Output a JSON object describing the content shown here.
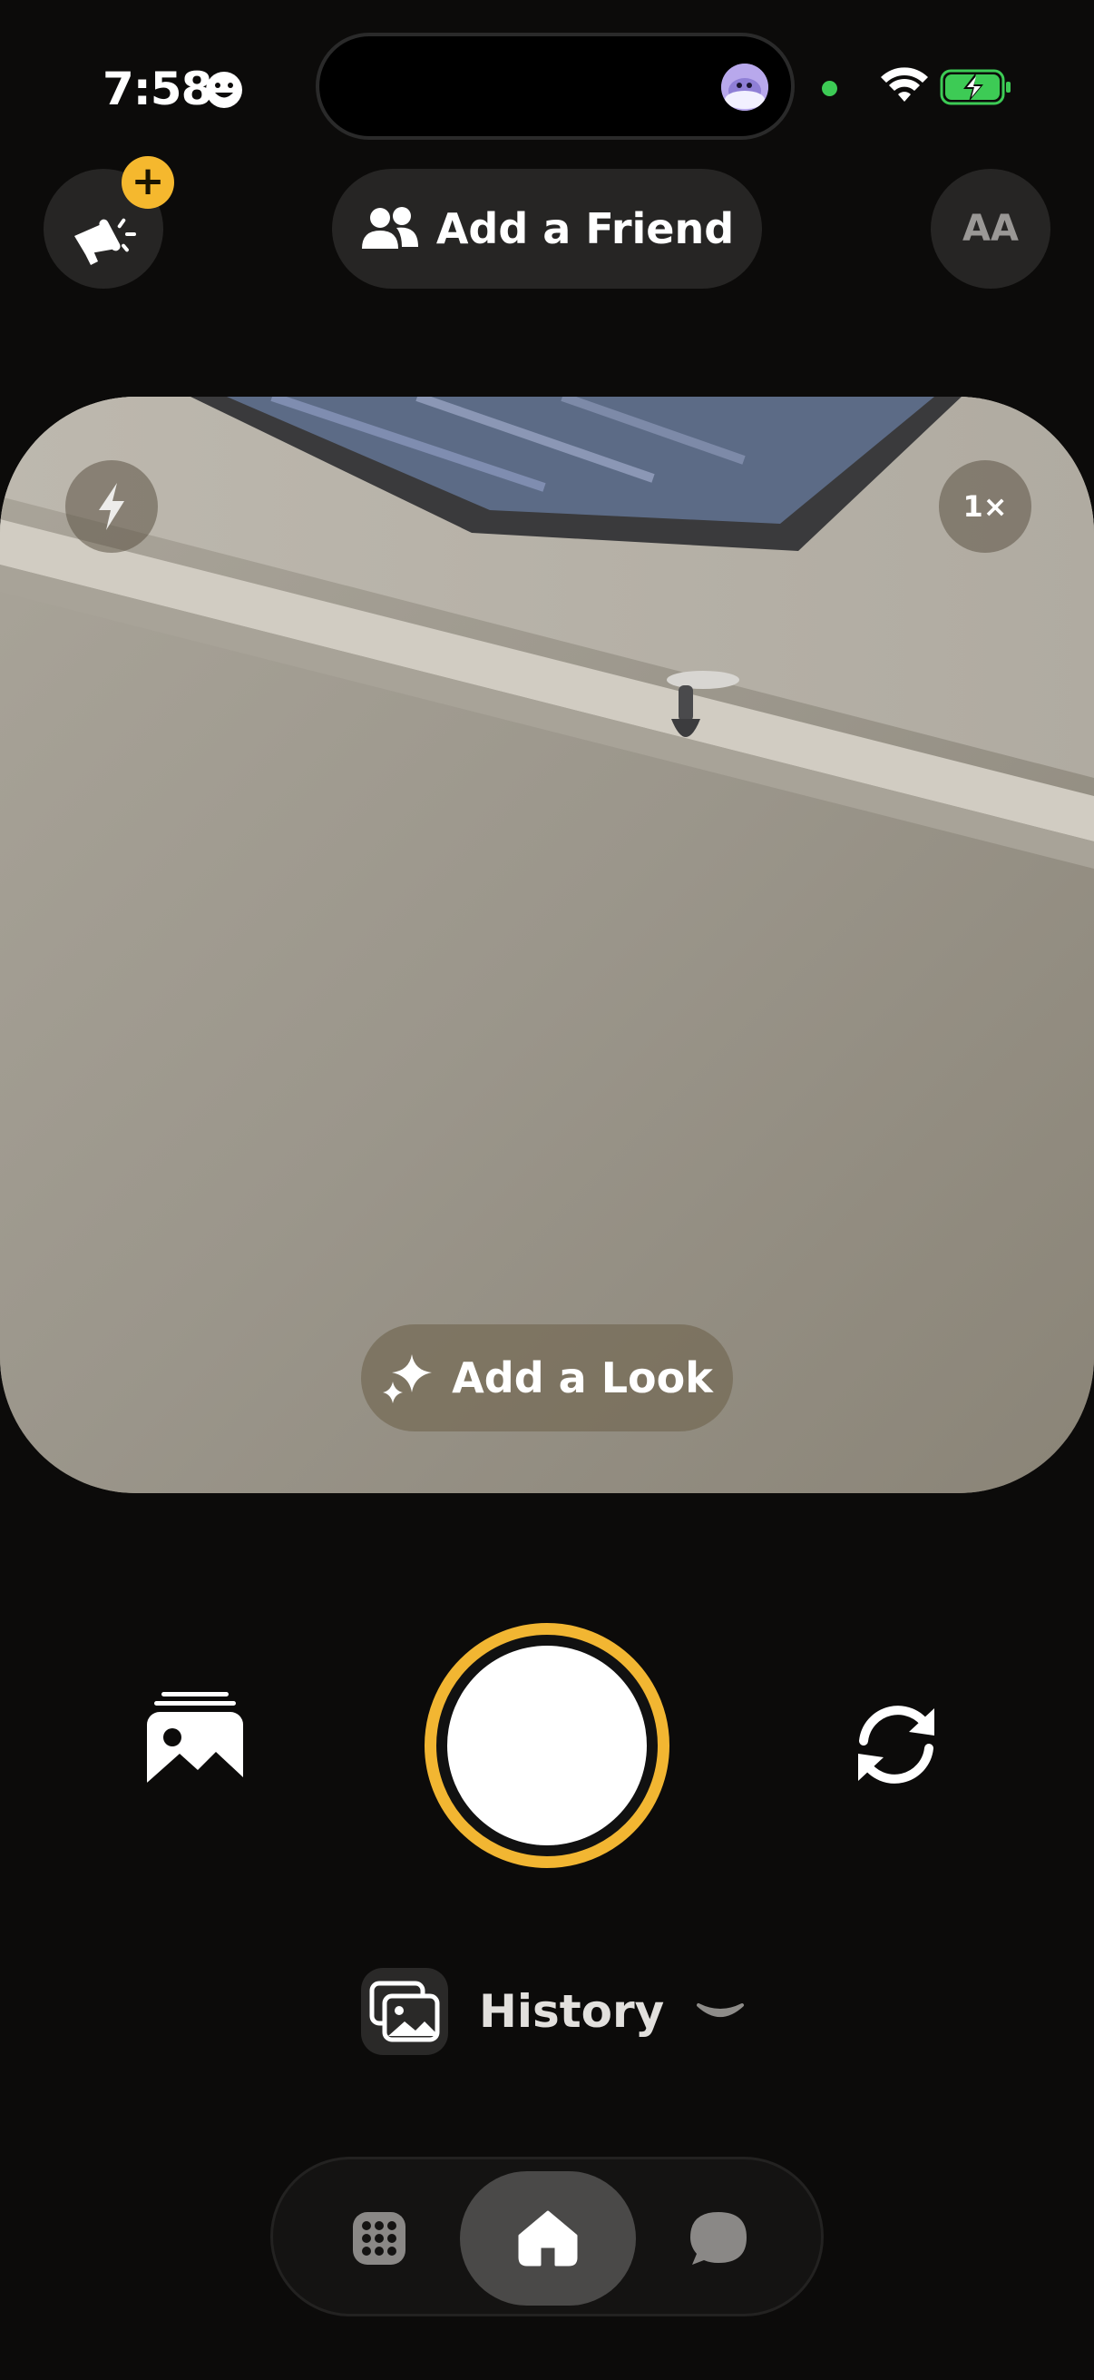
{
  "status_bar": {
    "time": "7:58",
    "time_icon": "smiley-face-icon",
    "island_icon": "avatar-icon",
    "indicator_color": "#3dcb55",
    "icons": [
      "wifi-icon",
      "battery-charging-icon"
    ]
  },
  "header": {
    "megaphone_icon": "megaphone-icon",
    "badge_label": "+",
    "add_friend_label": "Add a Friend",
    "friends_icon": "friends-icon",
    "font_button_label": "AA"
  },
  "camera": {
    "flash_icon": "flash-icon",
    "zoom_label": "1×",
    "add_look_label": "Add a Look",
    "add_look_icon": "sparkles-icon"
  },
  "controls": {
    "gallery_icon": "gallery-icon",
    "shutter_ring_color": "#f2b632",
    "flip_icon": "flip-camera-icon"
  },
  "history": {
    "label": "History",
    "icon": "photos-icon",
    "chevron": "chevron-down-icon"
  },
  "tab_bar": {
    "items": [
      "grid-icon",
      "home-icon",
      "chat-icon"
    ],
    "active": "home-icon"
  },
  "colors": {
    "background": "#0c0b0a",
    "accent": "#f2b632",
    "badge": "#f5b82e"
  }
}
